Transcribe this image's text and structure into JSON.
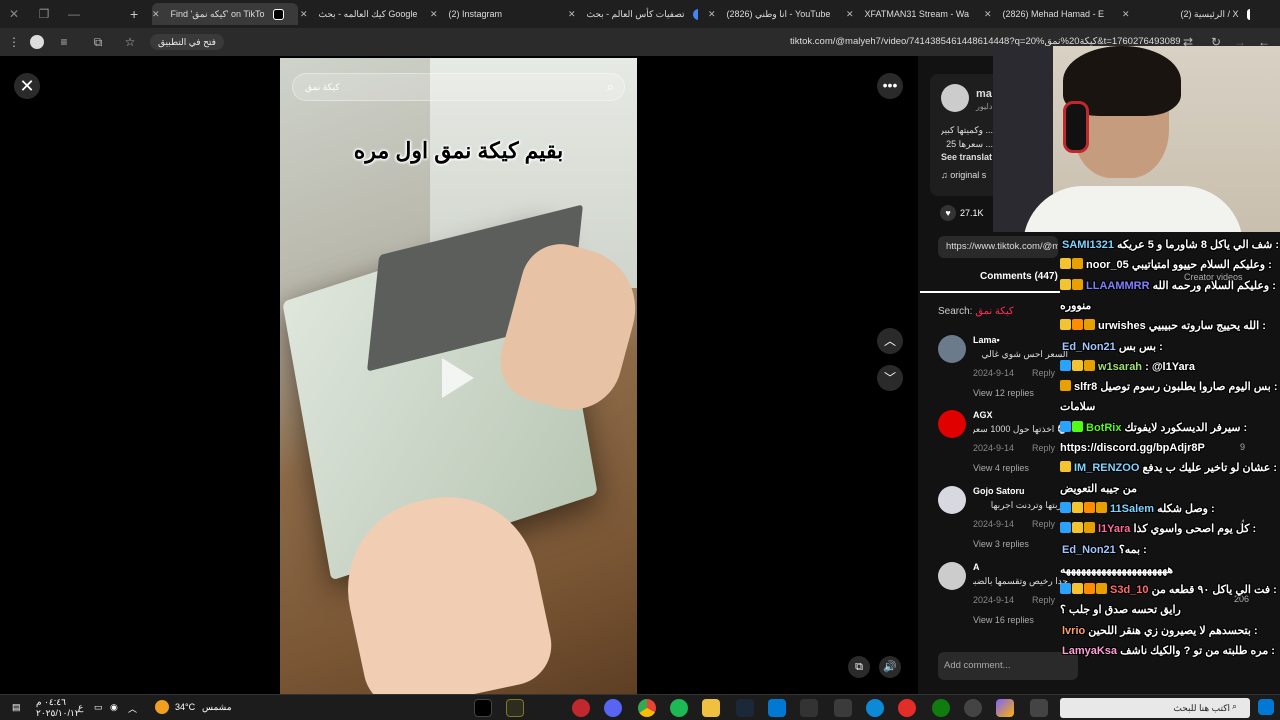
{
  "browser": {
    "tabs": [
      {
        "label": "Find 'كيكه نمق' on TikTo",
        "favicon_color": "#ffffff",
        "active": true
      },
      {
        "label": "كيك العالمه - بحث Google",
        "favicon_color": "#4285f4",
        "active": false
      },
      {
        "label": "(2) Instagram",
        "favicon_color": "#e1306c",
        "active": false
      },
      {
        "label": "تصفيات كأس العالم - بحث",
        "favicon_color": "#4285f4",
        "active": false
      },
      {
        "label": "انا وطني (2826) - YouTube",
        "favicon_color": "#ff0000",
        "active": false
      },
      {
        "label": "XFATMAN31 Stream - Wa",
        "favicon_color": "#53fc18",
        "active": false
      },
      {
        "label": "(2826) Mehad Hamad - E",
        "favicon_color": "#ff0000",
        "active": false
      },
      {
        "label": "(2) الرئيسية / X",
        "favicon_color": "#ffffff",
        "active": false
      }
    ],
    "open_in_app": "فتح في التطبيق",
    "url": "tiktok.com/@malyeh7/video/7414385461448614448?q=20%كيكة20%نمق&t=1760276493089"
  },
  "video": {
    "search_placeholder": "كيكة نمق",
    "caption": "بقيم كيكة نمق اول مره"
  },
  "panel": {
    "author_short": "ma",
    "author_sub": "دليور",
    "desc_line1": "... وكميتها كبيره",
    "desc_line2": "... سعرها 25",
    "see_translation": "See translat",
    "sound": "original s",
    "likes": "27.1K",
    "link": "https://www.tiktok.com/@m",
    "comments_tab": "Comments (447)",
    "search_label": "Search:",
    "search_query": "كيكة نمق",
    "comments": [
      {
        "name": "Lama•",
        "text": "السعر احس شوي غالي",
        "date": "2024-9-14",
        "reply": "Reply",
        "view": "View 12 replies",
        "avatar_color": "#6b7b8c"
      },
      {
        "name": "AGX",
        "text": "💀 اخذتها حول 1000 سعرة",
        "date": "2024-9-14",
        "reply": "Reply",
        "view": "View 4 replies",
        "avatar_color": "#e00000"
      },
      {
        "name": "Gojo Satoru",
        "text": "جربتها وتردنت اجربها",
        "date": "2024-9-14",
        "reply": "Reply",
        "view": "View 3 replies",
        "avatar_color": "#d8d8e0"
      },
      {
        "name": "A",
        "text": "جدا رخيص وتقسمها بالضبط",
        "date": "2024-9-14",
        "reply": "Reply",
        "view": "View 16 replies",
        "avatar_color": "#cccccc"
      }
    ],
    "add_comment": "Add comment..."
  },
  "chat": {
    "messages": [
      {
        "user": "SAMI1321",
        "user_color": "#7fd4ff",
        "text": "شف الي ياكل 8 شاورما و 5 عريكه :",
        "badges": []
      },
      {
        "user": "noor_05",
        "user_color": "#ffffff",
        "text": "وعليكم السلام حييوو امتياتيبي :",
        "badges": [
          "#f4c430",
          "#e8a000"
        ]
      },
      {
        "user": "LLAAMMRR",
        "user_color": "#7f7fff",
        "text": "وعليكم السلام ورحمه الله :",
        "badges": [
          "#f4c430",
          "#e8a000"
        ]
      },
      {
        "user": "",
        "user_color": "#ffffff",
        "text": "منووره",
        "badges": []
      },
      {
        "user": "urwishes",
        "user_color": "#ffffff",
        "text": "الله يحييج ساروته حبيبيي :",
        "badges": [
          "#f4c430",
          "#ff8c00",
          "#e8a000"
        ]
      },
      {
        "user": "Ed_Non21",
        "user_color": "#9fc6ff",
        "text": "بس بس :",
        "badges": []
      },
      {
        "user": "w1sarah",
        "user_color": "#9fe06f",
        "text": ": @l1Yara",
        "badges": [
          "#2aa3ff",
          "#f4c430",
          "#e8a000"
        ]
      },
      {
        "user": "slfr8",
        "user_color": "#ffffff",
        "text": "بس اليوم صاروا يطلبون رسوم توصيل :",
        "badges": [
          "#e8a000"
        ]
      },
      {
        "user": "",
        "user_color": "#ffffff",
        "text": "سلامات",
        "badges": []
      },
      {
        "user": "BotRix",
        "user_color": "#53fc18",
        "text": "سيرفر الديسكورد لايفوتك :",
        "badges": [
          "#2aa3ff",
          "#53fc18"
        ]
      },
      {
        "user": "",
        "user_color": "#ffffff",
        "text": "https://discord.gg/bpAdjr8P",
        "badges": []
      },
      {
        "user": "IM_RENZOO",
        "user_color": "#7fd4ff",
        "text": "عشان لو تاخير عليك ب يدفع :",
        "badges": [
          "#f4c430"
        ]
      },
      {
        "user": "",
        "user_color": "#ffffff",
        "text": "من جيبه التعويض",
        "badges": []
      },
      {
        "user": "11Salem",
        "user_color": "#7fd4ff",
        "text": "وصل شكله :",
        "badges": [
          "#2aa3ff",
          "#f4c430",
          "#ff8c00",
          "#e8a000"
        ]
      },
      {
        "user": "l1Yara",
        "user_color": "#ff6b9d",
        "text": "كل يوم اصحى واسوي كذا :",
        "badges": [
          "#2aa3ff",
          "#f4c430",
          "#e8a000"
        ]
      },
      {
        "user": "Ed_Non21",
        "user_color": "#9fc6ff",
        "text": "بمه؟ :",
        "badges": []
      },
      {
        "user": "",
        "user_color": "#ffffff",
        "text": "هههههههههههههههههههههه",
        "badges": []
      },
      {
        "user": "S3d_10",
        "user_color": "#ff6b6b",
        "text": "فت الي ياكل ٩٠ قطعه من :",
        "badges": [
          "#2aa3ff",
          "#f4c430",
          "#ff8c00",
          "#e8a000"
        ]
      },
      {
        "user": "",
        "user_color": "#ffffff",
        "text": "رايق تحسه صدق او جلب ؟",
        "badges": []
      },
      {
        "user": "lvrio",
        "user_color": "#ff9f6b",
        "text": "بتحسدهم لا يصيرون زي هنقر اللحين :",
        "badges": []
      },
      {
        "user": "LamyaKsa",
        "user_color": "#ff9fd4",
        "text": "مره طلبته من تو ? والكيك ناشف :",
        "badges": []
      }
    ],
    "side_numbers": [
      "9",
      "4",
      "206"
    ],
    "creator_videos": "Creator videos"
  },
  "taskbar": {
    "time": "٠٤:٤٦ م",
    "date": "٢٠٢٥/١٠/١٢",
    "lang": "ع",
    "temp": "34°C",
    "weather": "مشمس",
    "search_text": "اكتب هنا للبحث"
  },
  "colors": {
    "tiktok_red": "#fe2c55",
    "chrome_bg": "#1f1f1f",
    "panel_bg": "#121212"
  }
}
